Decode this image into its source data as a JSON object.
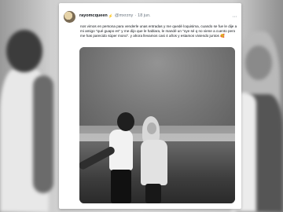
{
  "tweet": {
    "author_name": "rayomcqueen",
    "author_emoji": "⚡",
    "handle": "@mxrzny",
    "separator": "·",
    "time": "18 jun.",
    "more_label": "···",
    "text": "nos vimos en persona para venderle unas entradas y me quedé loquisima, cuando se fue le dije a mi amigo \"qué guapo es\" y me dijo que le hablara, le mandé un \"oye sé q no viene a cuento pero me has parecido súper mono\". y ahora llevamos casi 4 años y estamos viviendo juntos 🥰"
  }
}
